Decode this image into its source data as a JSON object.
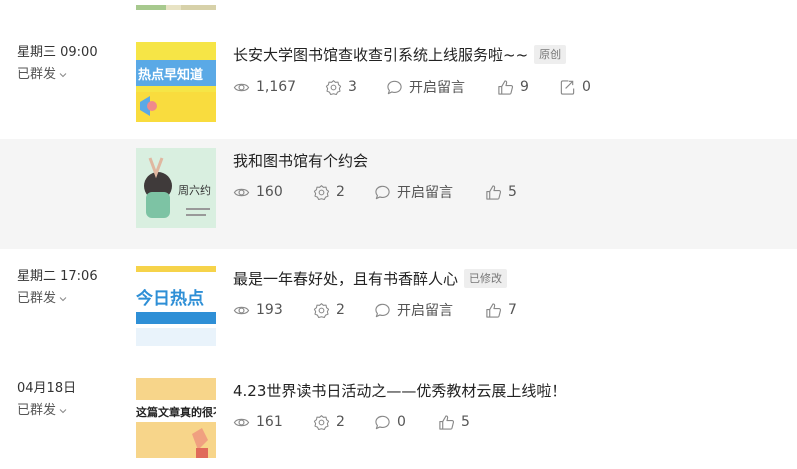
{
  "articles": [
    {
      "date": "星期三 09:00",
      "status": "已群发",
      "title": "长安大学图书馆查收查引系统上线服务啦~~",
      "badge": "原创",
      "thumb_text": "热点早知道",
      "stats": {
        "views": "1,167",
        "shares": "3",
        "comment": "开启留言",
        "likes": "9",
        "forwards": "0"
      }
    },
    {
      "date": "",
      "status": "",
      "title": "我和图书馆有个约会",
      "badge": "",
      "thumb_text": "周六约",
      "stats": {
        "views": "160",
        "shares": "2",
        "comment": "开启留言",
        "likes": "5"
      }
    },
    {
      "date": "星期二 17:06",
      "status": "已群发",
      "title": "最是一年春好处，且有书香醉人心",
      "badge": "已修改",
      "thumb_text": "今日热点",
      "stats": {
        "views": "193",
        "shares": "2",
        "comment": "开启留言",
        "likes": "7"
      }
    },
    {
      "date": "04月18日",
      "status": "已群发",
      "title": "4.23世界读书日活动之——优秀教材云展上线啦！",
      "badge": "",
      "thumb_text": "这篇文章真的很不",
      "stats": {
        "views": "161",
        "shares": "2",
        "comments": "0",
        "likes": "5"
      }
    }
  ],
  "icons": {
    "views": "eye-icon",
    "shares": "gear-share-icon",
    "comment": "comment-bubble-icon",
    "likes": "thumbs-up-icon",
    "forwards": "forward-icon",
    "status_toggle": "chevron-down-icon"
  },
  "colors": {
    "row_highlight": "#f5f5f5",
    "icon": "#888888"
  }
}
